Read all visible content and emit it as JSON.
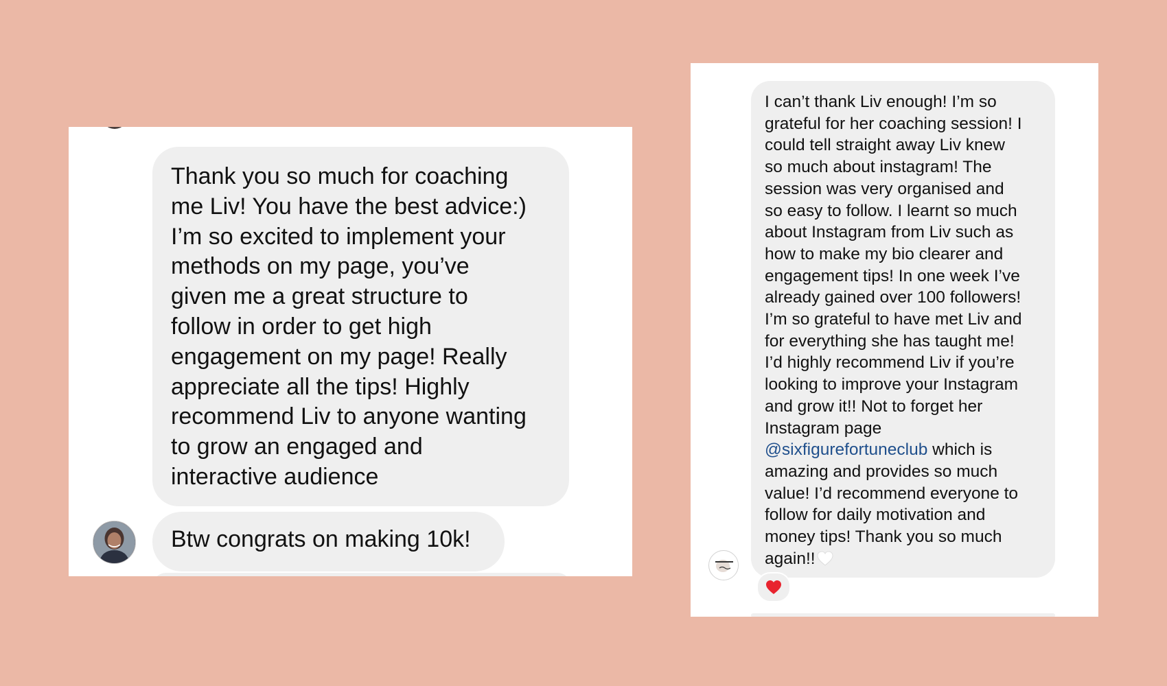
{
  "background_color": "#EBB8A6",
  "left_screenshot": {
    "messages": [
      {
        "lines": [
          "Thank you so much for coaching",
          "me Liv! You have the best advice:)",
          "I’m so excited to implement your",
          "methods on my page, you’ve",
          "given me a great structure to",
          "follow in order to get high",
          "engagement on my page! Really",
          "appreciate all the tips! Highly",
          "recommend Liv to anyone wanting",
          "to grow an engaged and",
          "interactive audience"
        ]
      },
      {
        "text": "Btw congrats on making 10k!"
      }
    ],
    "sender_avatar": "profile-photo-avatar"
  },
  "right_screenshot": {
    "message": {
      "lines": [
        "I can’t thank Liv enough! I’m so",
        "grateful for her coaching session! I",
        "could tell straight away Liv knew",
        "so much about instagram! The",
        "session was very organised and",
        "so easy to follow. I learnt so much",
        "about Instagram from Liv such as",
        "how to make my bio clearer and",
        "engagement tips! In one week I’ve",
        "already gained over 100 followers!",
        "I’m so grateful to have met Liv and",
        "for everything she has taught me!",
        "I’d highly recommend Liv if you’re",
        "looking to improve your Instagram",
        "and grow it!! Not to forget her",
        "Instagram page"
      ],
      "mention": "@sixfigurefortuneclub",
      "mention_tail": " which is",
      "lines_after": [
        "amazing and provides so much",
        "value! I’d recommend everyone to",
        "follow for daily motivation and",
        "money tips! Thank you so much"
      ],
      "last_line": "again!!",
      "trailing_emoji": "white-heart-icon",
      "mention_color": "#1F4F8C"
    },
    "reaction": "red-heart-icon",
    "sender_avatar": "brand-logo-avatar"
  }
}
